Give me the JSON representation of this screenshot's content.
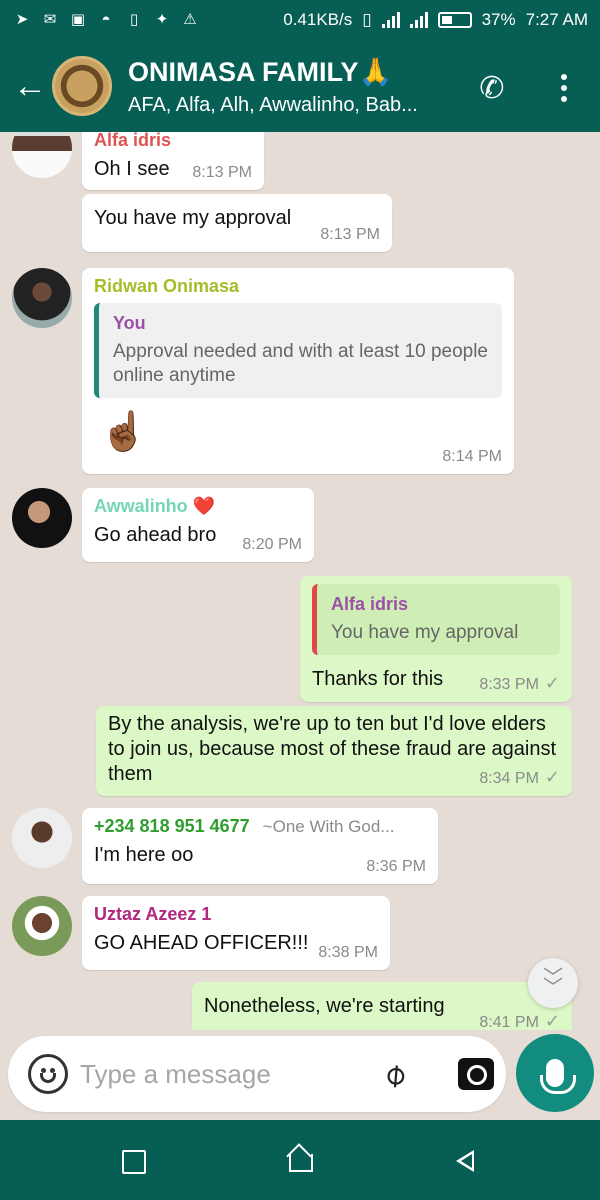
{
  "status_bar": {
    "net_speed": "0.41KB/s",
    "battery": "37%",
    "time": "7:27 AM",
    "icons": [
      "telegram-icon",
      "mail-icon",
      "gallery-icon",
      "incognito-icon",
      "sim-icon",
      "twitter-icon",
      "warning-icon"
    ]
  },
  "header": {
    "title": "ONIMASA FAMILY🙏",
    "subtitle": "AFA, Alfa, Alh, Awwalinho, Bab..."
  },
  "messages": [
    {
      "type": "in",
      "sender": "Alfa idris",
      "sender_color": "#e05353",
      "text": "Oh I see",
      "time": "8:13 PM"
    },
    {
      "type": "in",
      "text": "You have my approval",
      "time": "8:13 PM"
    },
    {
      "type": "in",
      "sender": "Ridwan Onimasa",
      "sender_color": "#a6bd2a",
      "quote_name": "You",
      "quote_text": "Approval needed and with at least 10 people online anytime",
      "text": "☝🏾",
      "time": "8:14 PM"
    },
    {
      "type": "in",
      "sender": "Awwalinho ❤️",
      "sender_color": "#74d6b6",
      "text": "Go ahead bro",
      "time": "8:20 PM"
    },
    {
      "type": "out",
      "quote_name": "Alfa idris",
      "quote_text": "You have my approval",
      "text": "Thanks for this",
      "time": "8:33 PM"
    },
    {
      "type": "out",
      "text": "By the analysis, we're up to ten but I'd love elders to join us, because most of these fraud are against them",
      "time": "8:34 PM"
    },
    {
      "type": "in",
      "sender": "+234 818 951 4677",
      "sender_color": "#2f9e2f",
      "sender_note": "~One With God...",
      "text": "I'm here oo",
      "time": "8:36 PM"
    },
    {
      "type": "in",
      "sender": "Uztaz Azeez 1",
      "sender_color": "#b1297e",
      "text": "GO AHEAD OFFICER!!!",
      "time": "8:38 PM"
    },
    {
      "type": "out",
      "text": "Nonetheless, we're starting",
      "time": "8:41 PM"
    }
  ],
  "input": {
    "placeholder": "Type a message"
  },
  "colors": {
    "header": "#075e54",
    "outgoing_bubble": "#dcf8c6",
    "incoming_bubble": "#ffffff",
    "mic_button": "#128c7e"
  }
}
